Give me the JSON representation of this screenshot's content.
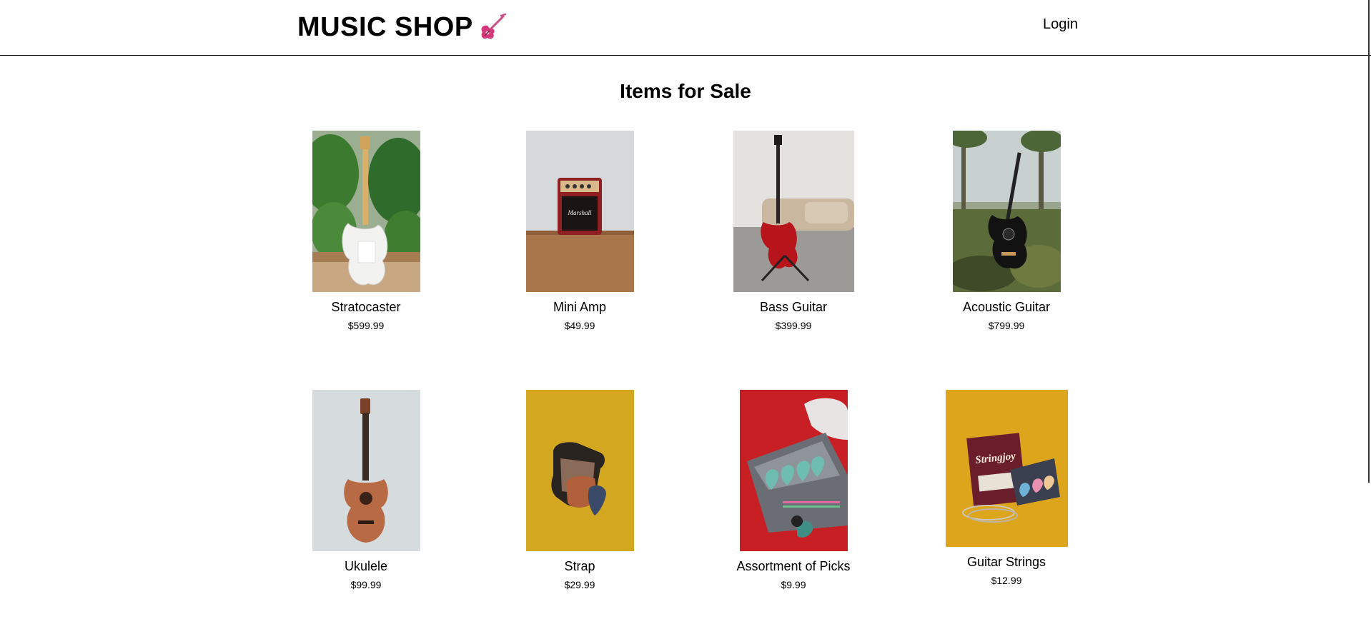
{
  "header": {
    "brand": "MUSIC SHOP",
    "brand_icon": "electric-guitar-icon",
    "login_label": "Login"
  },
  "main": {
    "title": "Items for Sale"
  },
  "products": [
    {
      "name": "Stratocaster",
      "price": "$599.99",
      "image": "white-stratocaster-photo"
    },
    {
      "name": "Mini Amp",
      "price": "$49.99",
      "image": "mini-amp-photo"
    },
    {
      "name": "Bass Guitar",
      "price": "$399.99",
      "image": "red-bass-guitar-photo"
    },
    {
      "name": "Acoustic Guitar",
      "price": "$799.99",
      "image": "black-acoustic-guitar-photo"
    },
    {
      "name": "Ukulele",
      "price": "$99.99",
      "image": "ukulele-photo"
    },
    {
      "name": "Strap",
      "price": "$29.99",
      "image": "guitar-strap-photo"
    },
    {
      "name": "Assortment of Picks",
      "price": "$9.99",
      "image": "guitar-picks-photo"
    },
    {
      "name": "Guitar Strings",
      "price": "$12.99",
      "image": "guitar-strings-photo"
    }
  ],
  "colors": {
    "accent": "#d4387a",
    "border": "#000000"
  }
}
